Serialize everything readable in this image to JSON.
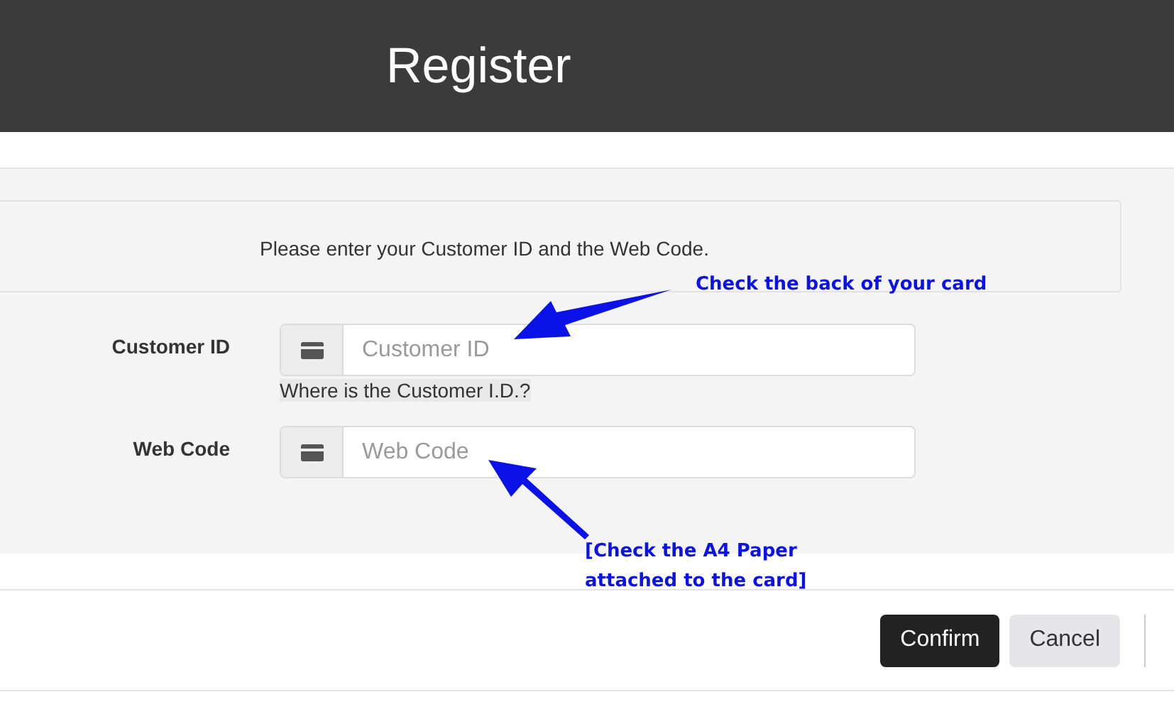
{
  "header": {
    "title": "Register"
  },
  "notice": "Please enter your Customer ID and the Web Code.",
  "fields": [
    {
      "label": "Customer ID",
      "placeholder": "Customer ID",
      "helper": "Where is the Customer I.D.?"
    },
    {
      "label": "Web Code",
      "placeholder": "Web Code"
    }
  ],
  "buttons": [
    {
      "label": "Confirm",
      "kind": "primary"
    },
    {
      "label": "Cancel",
      "kind": "secondary"
    }
  ],
  "annotations": [
    {
      "lines": [
        "Check the back of your card"
      ]
    },
    {
      "lines": [
        "[Check the A4 Paper",
        "attached to the card]"
      ]
    }
  ]
}
